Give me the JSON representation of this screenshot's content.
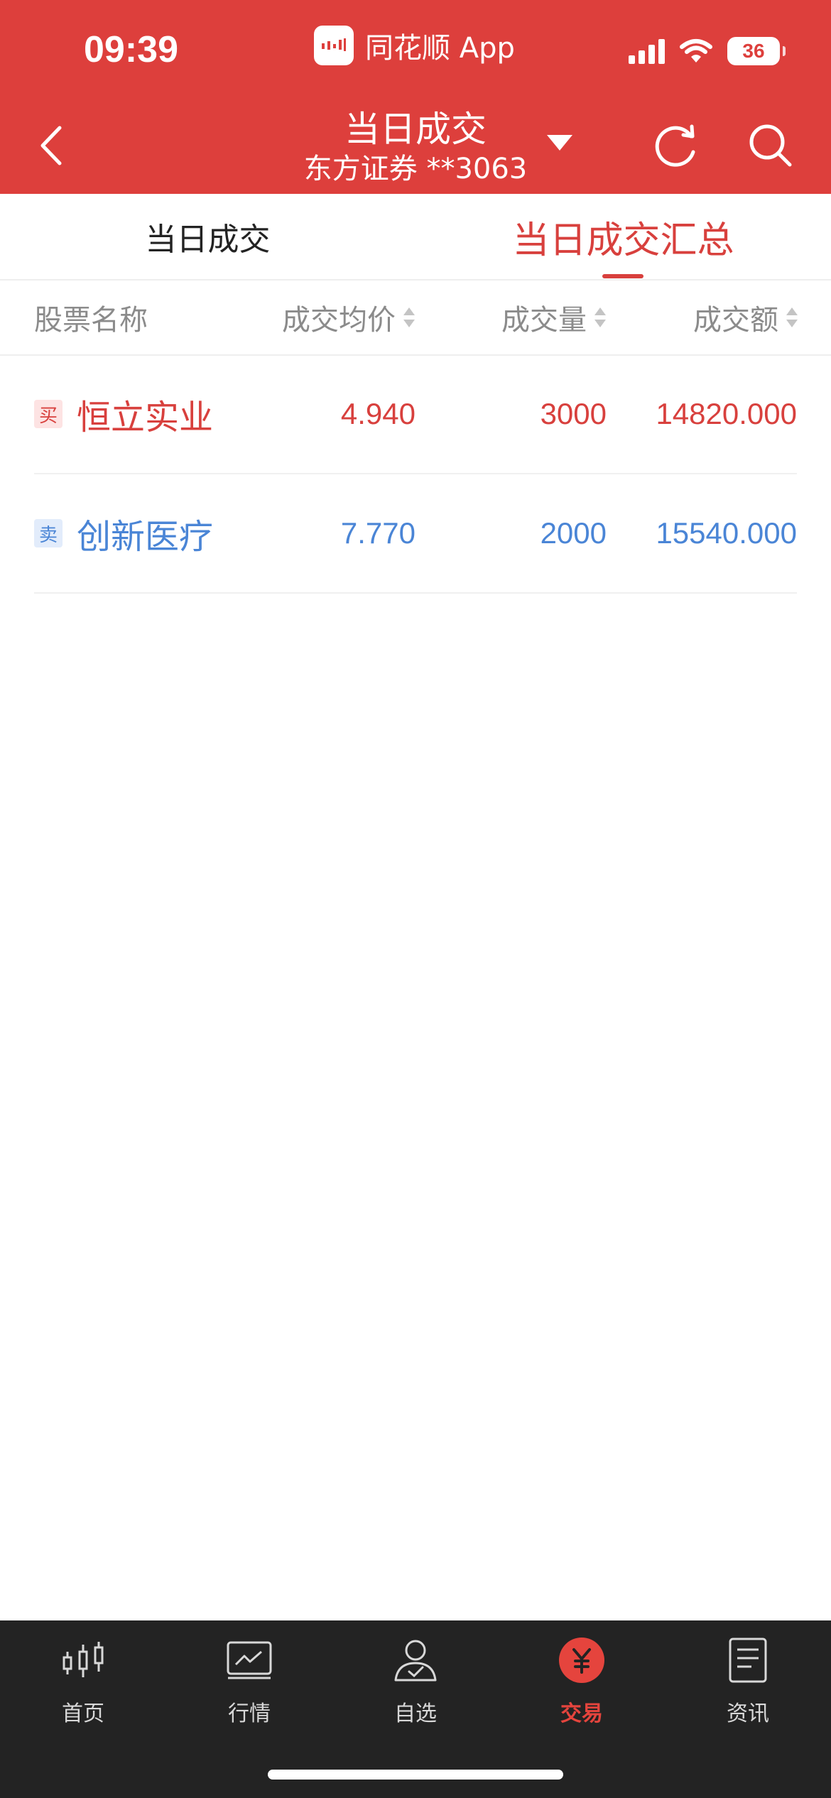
{
  "status_bar": {
    "time": "09:39",
    "app_name": "同花顺 App",
    "battery": "36"
  },
  "nav": {
    "title": "当日成交",
    "subtitle": "东方证券 **3063"
  },
  "tabs": [
    {
      "label": "当日成交",
      "active": false
    },
    {
      "label": "当日成交汇总",
      "active": true
    }
  ],
  "table": {
    "columns": [
      "股票名称",
      "成交均价",
      "成交量",
      "成交额"
    ],
    "rows": [
      {
        "tag": "买",
        "name": "恒立实业",
        "avg_price": "4.940",
        "volume": "3000",
        "amount": "14820.000",
        "color": "#d8403d",
        "tag_bg": "#fde3e3"
      },
      {
        "tag": "卖",
        "name": "创新医疗",
        "avg_price": "7.770",
        "volume": "2000",
        "amount": "15540.000",
        "color": "#4a85d6",
        "tag_bg": "#e2ecfb"
      }
    ]
  },
  "tabbar": [
    {
      "label": "首页",
      "icon": "candlestick-icon"
    },
    {
      "label": "行情",
      "icon": "market-chart-icon"
    },
    {
      "label": "自选",
      "icon": "user-watchlist-icon"
    },
    {
      "label": "交易",
      "icon": "yuan-trade-icon",
      "active": true
    },
    {
      "label": "资讯",
      "icon": "news-document-icon"
    }
  ],
  "colors": {
    "header_red": "#dd3f3c",
    "buy_red": "#d8403d",
    "sell_blue": "#4a85d6",
    "tabbar_bg": "#232323",
    "active_tab": "#e5443d"
  }
}
